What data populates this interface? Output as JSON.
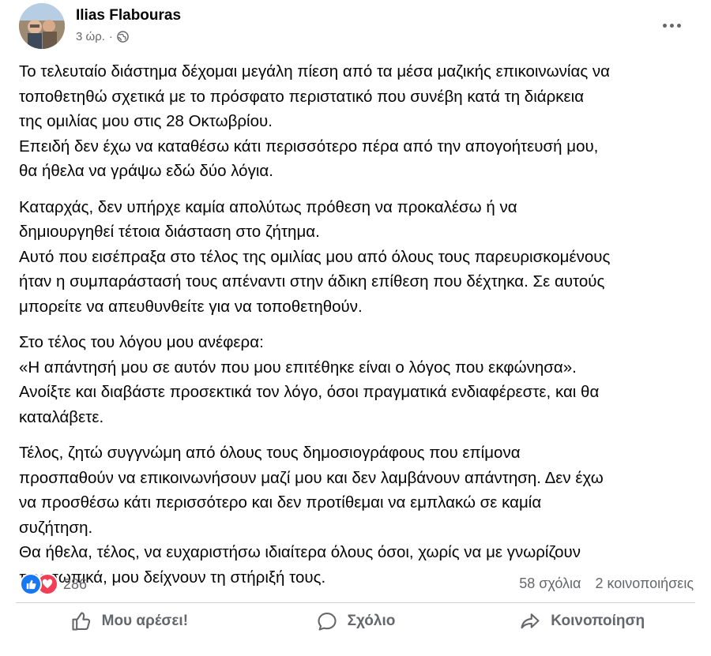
{
  "post": {
    "author": "Ilias Flabouras",
    "time": "3 ώρ.",
    "separator": "·",
    "visibility_icon": "globe-icon",
    "more_icon": "more-options-icon",
    "paragraphs": [
      [
        "Το τελευταίο διάστημα δέχομαι μεγάλη πίεση από τα μέσα μαζικής επικοινωνίας να",
        "τοποθετηθώ σχετικά με το πρόσφατο περιστατικό που συνέβη κατά τη διάρκεια",
        "της ομιλίας μου στις 28 Οκτωβρίου.",
        "Επειδή δεν έχω να καταθέσω κάτι περισσότερο πέρα από την απογοήτευσή μου,",
        "θα ήθελα να γράψω εδώ δύο λόγια."
      ],
      [
        "Καταρχάς, δεν υπήρχε καμία απολύτως πρόθεση να προκαλέσω ή να",
        "δημιουργηθεί τέτοια διάσταση στο ζήτημα.",
        "Αυτό που εισέπραξα στο τέλος της ομιλίας μου από όλους τους παρευρισκομένους",
        "ήταν η συμπαράστασή τους απέναντι στην άδικη επίθεση που δέχτηκα. Σε αυτούς",
        "μπορείτε να απευθυνθείτε για να τοποθετηθούν."
      ],
      [
        "Στο τέλος του λόγου μου ανέφερα:",
        "«Η απάντησή μου σε αυτόν που μου επιτέθηκε είναι ο λόγος που εκφώνησα».",
        "Ανοίξτε και διαβάστε προσεκτικά τον λόγο, όσοι πραγματικά ενδιαφέρεστε, και θα",
        "καταλάβετε."
      ],
      [
        "Τέλος, ζητώ συγγνώμη από όλους τους δημοσιογράφους που επίμονα",
        "προσπαθούν να επικοινωνήσουν μαζί μου και δεν λαμβάνουν απάντηση. Δεν έχω",
        "να προσθέσω κάτι περισσότερο και δεν προτίθεμαι να εμπλακώ σε καμία",
        "συζήτηση.",
        "Θα ήθελα, τέλος, να ευχαριστήσω ιδιαίτερα όλους όσοι, χωρίς να με γνωρίζουν",
        "προσωπικά, μου δείχνουν τη στήριξή τους."
      ]
    ],
    "reactions": {
      "icons": [
        "like-reaction-icon",
        "love-reaction-icon"
      ],
      "count": "286",
      "comments": "58 σχόλια",
      "shares": "2 κοινοποιήσεις"
    },
    "actions": {
      "like": "Μου αρέσει!",
      "comment": "Σχόλιο",
      "share": "Κοινοποίηση"
    },
    "colors": {
      "like_blue": "#1877f2",
      "love_red": "#f33e58",
      "secondary_text": "#65676b",
      "divider": "#ced0d4"
    }
  }
}
